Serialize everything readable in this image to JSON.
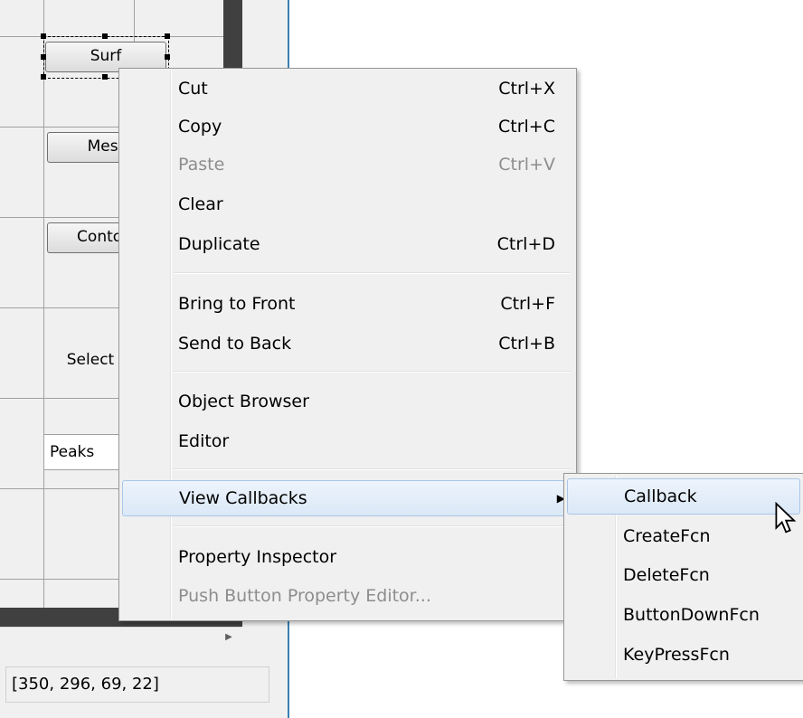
{
  "canvas": {
    "buttons": [
      "Surf",
      "Mesh",
      "Contour"
    ],
    "static_text": "Select",
    "popup_value": "Peaks"
  },
  "status": {
    "position_readout": "[350, 296, 69, 22]"
  },
  "context_menu": {
    "items": [
      {
        "label": "Cut",
        "shortcut": "Ctrl+X"
      },
      {
        "label": "Copy",
        "shortcut": "Ctrl+C"
      },
      {
        "label": "Paste",
        "shortcut": "Ctrl+V",
        "disabled": true
      },
      {
        "label": "Clear",
        "shortcut": ""
      },
      {
        "label": "Duplicate",
        "shortcut": "Ctrl+D"
      },
      {
        "label": "Bring to Front",
        "shortcut": "Ctrl+F"
      },
      {
        "label": "Send to Back",
        "shortcut": "Ctrl+B"
      },
      {
        "label": "Object Browser",
        "shortcut": ""
      },
      {
        "label": "Editor",
        "shortcut": ""
      },
      {
        "label": "View Callbacks",
        "shortcut": "",
        "submenu": true
      },
      {
        "label": "Property Inspector",
        "shortcut": ""
      },
      {
        "label": "Push Button Property Editor...",
        "shortcut": "",
        "disabled": true
      }
    ]
  },
  "callbacks_submenu": {
    "items": [
      "Callback",
      "CreateFcn",
      "DeleteFcn",
      "ButtonDownFcn",
      "KeyPressFcn"
    ]
  },
  "icons": {
    "submenu_arrow": "▶",
    "scroll_right": "▶"
  },
  "colors": {
    "menu_bg": "#f0f0f0",
    "highlight_border": "#a9c6ea",
    "disabled_text": "#8d8d8d",
    "window_border": "#3c7fb1"
  }
}
